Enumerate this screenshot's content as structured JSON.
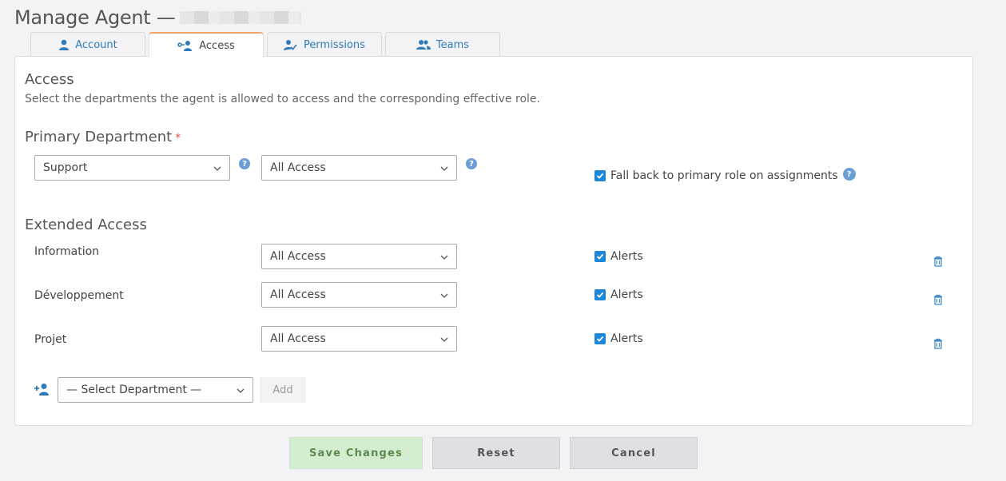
{
  "header": {
    "title": "Manage Agent —"
  },
  "tabs": [
    {
      "label": "Account",
      "icon": "user-icon",
      "active": false
    },
    {
      "label": "Access",
      "icon": "user-key-icon",
      "active": true
    },
    {
      "label": "Permissions",
      "icon": "user-check-icon",
      "active": false
    },
    {
      "label": "Teams",
      "icon": "users-icon",
      "active": false
    }
  ],
  "access": {
    "title": "Access",
    "description": "Select the departments the agent is allowed to access and the corresponding effective role."
  },
  "primary": {
    "title": "Primary Department",
    "required_mark": "*",
    "department": "Support",
    "role": "All Access",
    "fallback_label": "Fall back to primary role on assignments",
    "fallback_checked": true
  },
  "extended": {
    "title": "Extended Access",
    "rows": [
      {
        "department": "Information",
        "role": "All Access",
        "alerts_label": "Alerts",
        "alerts_checked": true
      },
      {
        "department": "Développement",
        "role": "All Access",
        "alerts_label": "Alerts",
        "alerts_checked": true
      },
      {
        "department": "Projet",
        "role": "All Access",
        "alerts_label": "Alerts",
        "alerts_checked": true
      }
    ],
    "select_placeholder": "— Select Department —",
    "add_label": "Add"
  },
  "footer": {
    "save_label": "Save Changes",
    "reset_label": "Reset",
    "cancel_label": "Cancel"
  },
  "colors": {
    "link": "#2e7bb7",
    "active_tab_accent": "#f4a66a",
    "checkbox": "#1e88d8",
    "save_bg": "#d4ecd0",
    "save_text": "#5f8a4f",
    "button_bg": "#dfe0e3",
    "required": "#d9534f"
  }
}
